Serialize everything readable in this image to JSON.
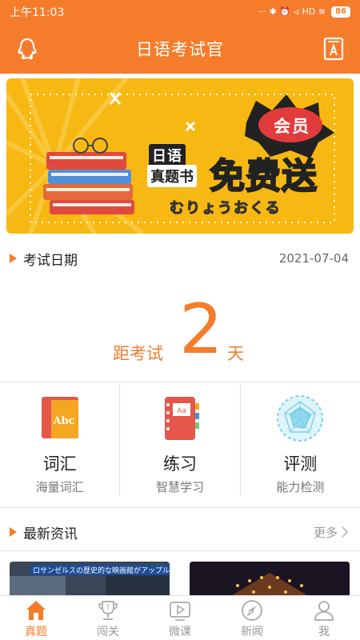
{
  "status_bar": {
    "time": "上午11:03",
    "indicators": "··· ✱ ⏰ ⏿ HD ≋",
    "battery": "86"
  },
  "header": {
    "title": "日语考试官",
    "left_icon": "qq-icon",
    "right_icon": "dictionary-icon"
  },
  "banner": {
    "label1": "日语",
    "label2": "真题书",
    "headline": "免费送",
    "badge": "会员",
    "kana": "むりょうおくる",
    "accent_color": "#f7b813"
  },
  "exam": {
    "label": "考试日期",
    "date": "2021-07-04",
    "countdown_prefix": "距考试",
    "countdown_number": "2",
    "countdown_suffix": "天"
  },
  "features": [
    {
      "title": "词汇",
      "subtitle": "海量词汇",
      "icon": "vocabulary-book-icon",
      "icon_text": "Abc"
    },
    {
      "title": "练习",
      "subtitle": "智慧学习",
      "icon": "practice-notebook-icon",
      "icon_text": "Aa"
    },
    {
      "title": "评测",
      "subtitle": "能力检测",
      "icon": "radar-chart-icon"
    }
  ],
  "news": {
    "label": "最新资讯",
    "more": "更多",
    "thumb1_caption": "ロサンゼルスの歴史的な映画館がアップル新店舗に"
  },
  "bottom_nav": [
    {
      "label": "真题",
      "icon": "home-icon",
      "active": true
    },
    {
      "label": "闯关",
      "icon": "trophy-icon",
      "active": false
    },
    {
      "label": "微课",
      "icon": "play-icon",
      "active": false
    },
    {
      "label": "新闻",
      "icon": "compass-icon",
      "active": false
    },
    {
      "label": "我",
      "icon": "user-icon",
      "active": false
    }
  ],
  "colors": {
    "primary": "#f57c2b",
    "text": "#222222",
    "muted": "#777777"
  }
}
